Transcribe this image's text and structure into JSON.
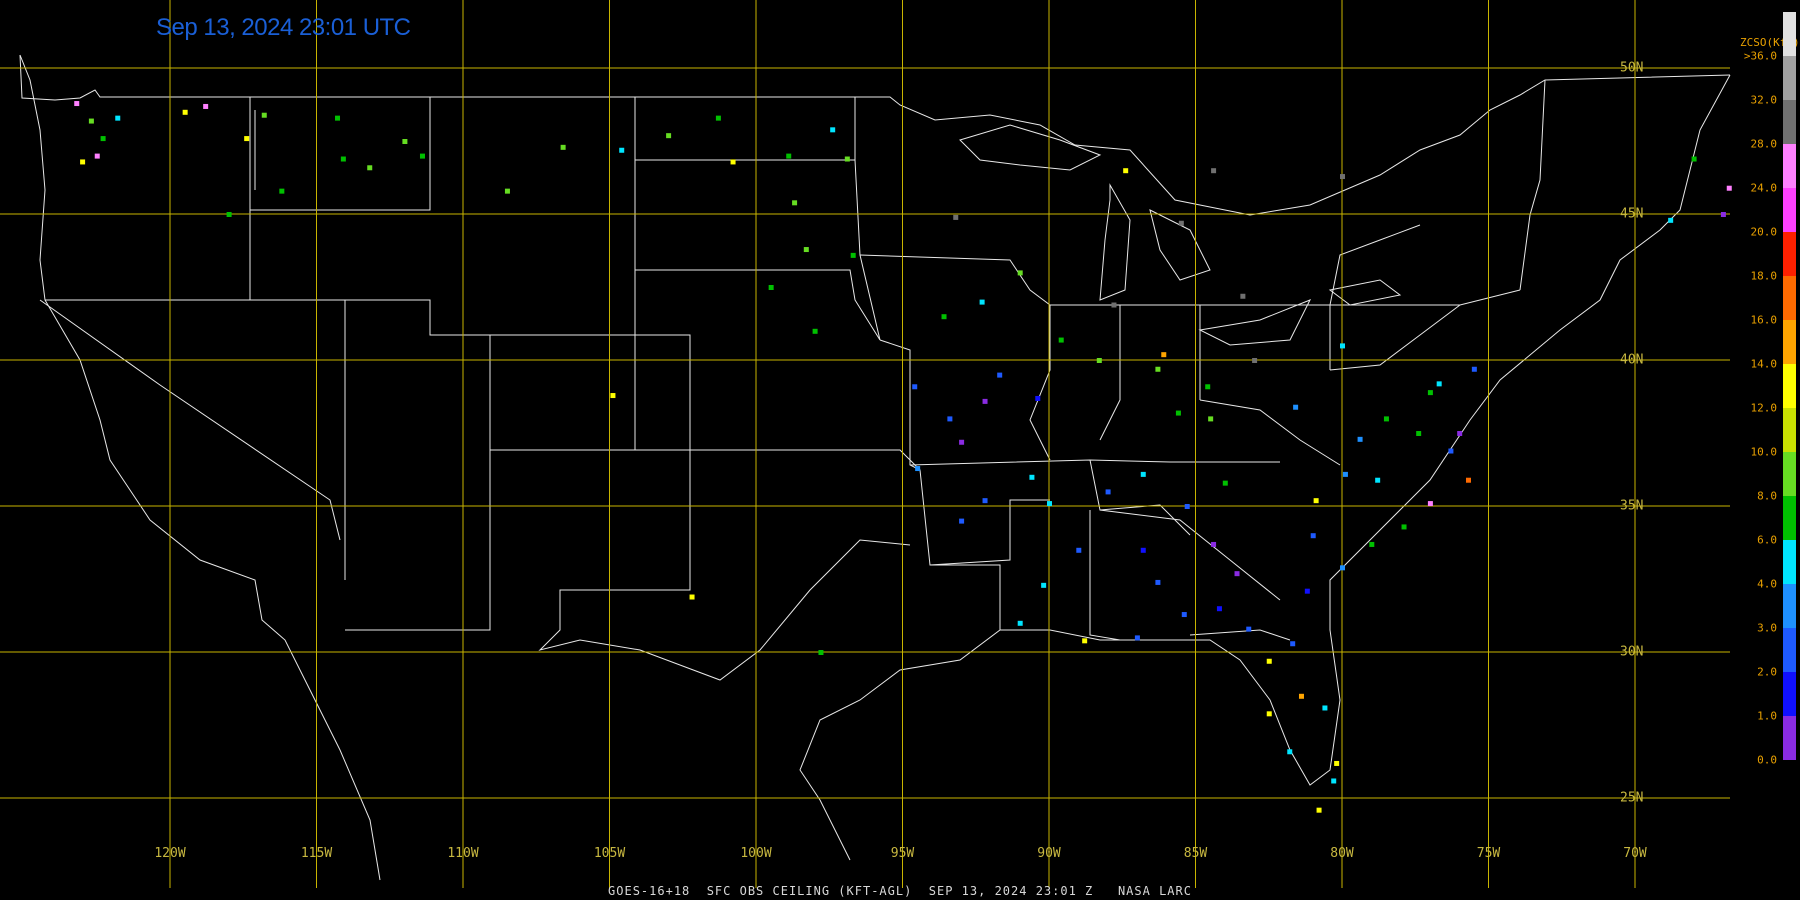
{
  "timestamp": "Sep 13, 2024 23:01 UTC",
  "footer": "GOES-16+18  SFC OBS CEILING (KFT-AGL)  SEP 13, 2024 23:01 Z   NASA LARC",
  "grid": {
    "longitudes": [
      {
        "lon": -120,
        "label": "120W"
      },
      {
        "lon": -115,
        "label": "115W"
      },
      {
        "lon": -110,
        "label": "110W"
      },
      {
        "lon": -105,
        "label": "105W"
      },
      {
        "lon": -100,
        "label": "100W"
      },
      {
        "lon": -95,
        "label": "95W"
      },
      {
        "lon": -90,
        "label": "90W"
      },
      {
        "lon": -85,
        "label": "85W"
      },
      {
        "lon": -80,
        "label": "80W"
      },
      {
        "lon": -75,
        "label": "75W"
      },
      {
        "lon": -70,
        "label": "70W"
      }
    ],
    "latitudes": [
      {
        "lat": 50,
        "label": "50N"
      },
      {
        "lat": 45,
        "label": "45N"
      },
      {
        "lat": 40,
        "label": "40N"
      },
      {
        "lat": 35,
        "label": "35N"
      },
      {
        "lat": 30,
        "label": "30N"
      },
      {
        "lat": 25,
        "label": "25N"
      }
    ],
    "color": "#c8b400"
  },
  "colorbar": {
    "title": "ZCSO(Kft)",
    "top_label": ">36.0",
    "ticks": [
      "0.0",
      "1.0",
      "2.0",
      "3.0",
      "4.0",
      "6.0",
      "8.0",
      "10.0",
      "12.0",
      "14.0",
      "16.0",
      "18.0",
      "20.0",
      "24.0",
      "28.0",
      "32.0"
    ],
    "colors": [
      "#8a2be2",
      "#1010ff",
      "#1e5aff",
      "#1e90ff",
      "#00e5ff",
      "#00c000",
      "#66dd22",
      "#c8e000",
      "#ffff00",
      "#ffa500",
      "#ff6a00",
      "#ff2000",
      "#ff40ff",
      "#ff80ff",
      "#707070",
      "#a0a0a0",
      "#e0e0e0"
    ]
  },
  "observations": [
    {
      "lon": -123.2,
      "lat": 48.8,
      "c": "#ff80ff"
    },
    {
      "lon": -122.7,
      "lat": 48.2,
      "c": "#66dd22"
    },
    {
      "lon": -122.3,
      "lat": 47.6,
      "c": "#00c000"
    },
    {
      "lon": -122.5,
      "lat": 47.0,
      "c": "#ff80ff"
    },
    {
      "lon": -123.0,
      "lat": 46.8,
      "c": "#ffff00"
    },
    {
      "lon": -121.8,
      "lat": 48.3,
      "c": "#00e5ff"
    },
    {
      "lon": -119.5,
      "lat": 48.5,
      "c": "#ffff00"
    },
    {
      "lon": -118.8,
      "lat": 48.7,
      "c": "#ff80ff"
    },
    {
      "lon": -117.4,
      "lat": 47.6,
      "c": "#ffff00"
    },
    {
      "lon": -116.8,
      "lat": 48.4,
      "c": "#66dd22"
    },
    {
      "lon": -114.3,
      "lat": 48.3,
      "c": "#00c000"
    },
    {
      "lon": -112.0,
      "lat": 47.5,
      "c": "#66dd22"
    },
    {
      "lon": -111.4,
      "lat": 47.0,
      "c": "#00c000"
    },
    {
      "lon": -113.2,
      "lat": 46.6,
      "c": "#66dd22"
    },
    {
      "lon": -114.1,
      "lat": 46.9,
      "c": "#00c000"
    },
    {
      "lon": -116.2,
      "lat": 45.8,
      "c": "#00c000"
    },
    {
      "lon": -118.0,
      "lat": 45.0,
      "c": "#00c000"
    },
    {
      "lon": -108.5,
      "lat": 45.8,
      "c": "#66dd22"
    },
    {
      "lon": -106.6,
      "lat": 47.3,
      "c": "#66dd22"
    },
    {
      "lon": -104.6,
      "lat": 47.2,
      "c": "#00e5ff"
    },
    {
      "lon": -103.0,
      "lat": 47.7,
      "c": "#66dd22"
    },
    {
      "lon": -101.3,
      "lat": 48.3,
      "c": "#00c000"
    },
    {
      "lon": -100.8,
      "lat": 46.8,
      "c": "#ffff00"
    },
    {
      "lon": -98.9,
      "lat": 47.0,
      "c": "#00c000"
    },
    {
      "lon": -97.4,
      "lat": 47.9,
      "c": "#00e5ff"
    },
    {
      "lon": -96.9,
      "lat": 46.9,
      "c": "#66dd22"
    },
    {
      "lon": -98.7,
      "lat": 45.4,
      "c": "#66dd22"
    },
    {
      "lon": -96.7,
      "lat": 43.6,
      "c": "#00c000"
    },
    {
      "lon": -99.5,
      "lat": 42.5,
      "c": "#00c000"
    },
    {
      "lon": -98.0,
      "lat": 41.0,
      "c": "#00c000"
    },
    {
      "lon": -98.3,
      "lat": 43.8,
      "c": "#66dd22"
    },
    {
      "lon": -104.9,
      "lat": 38.8,
      "c": "#ffff00"
    },
    {
      "lon": -97.8,
      "lat": 30.0,
      "c": "#00c000"
    },
    {
      "lon": -102.2,
      "lat": 31.9,
      "c": "#ffff00"
    },
    {
      "lon": -93.6,
      "lat": 41.5,
      "c": "#00c000"
    },
    {
      "lon": -92.3,
      "lat": 42.0,
      "c": "#00e5ff"
    },
    {
      "lon": -93.2,
      "lat": 44.9,
      "c": "#707070"
    },
    {
      "lon": -91.0,
      "lat": 43.0,
      "c": "#66dd22"
    },
    {
      "lon": -94.6,
      "lat": 39.1,
      "c": "#1e5aff"
    },
    {
      "lon": -93.4,
      "lat": 38.0,
      "c": "#1e5aff"
    },
    {
      "lon": -92.2,
      "lat": 38.6,
      "c": "#8a2be2"
    },
    {
      "lon": -90.4,
      "lat": 38.7,
      "c": "#1010ff"
    },
    {
      "lon": -91.7,
      "lat": 39.5,
      "c": "#1e5aff"
    },
    {
      "lon": -93.0,
      "lat": 37.2,
      "c": "#8a2be2"
    },
    {
      "lon": -94.5,
      "lat": 36.3,
      "c": "#1e90ff"
    },
    {
      "lon": -92.2,
      "lat": 35.2,
      "c": "#1e5aff"
    },
    {
      "lon": -93.0,
      "lat": 34.5,
      "c": "#1e5aff"
    },
    {
      "lon": -90.6,
      "lat": 36.0,
      "c": "#00e5ff"
    },
    {
      "lon": -89.6,
      "lat": 40.7,
      "c": "#00c000"
    },
    {
      "lon": -88.3,
      "lat": 40.0,
      "c": "#66dd22"
    },
    {
      "lon": -87.8,
      "lat": 41.9,
      "c": "#707070"
    },
    {
      "lon": -86.3,
      "lat": 39.7,
      "c": "#66dd22"
    },
    {
      "lon": -86.1,
      "lat": 40.2,
      "c": "#ffa500"
    },
    {
      "lon": -85.6,
      "lat": 38.2,
      "c": "#00c000"
    },
    {
      "lon": -84.6,
      "lat": 39.1,
      "c": "#00c000"
    },
    {
      "lon": -83.0,
      "lat": 40.0,
      "c": "#707070"
    },
    {
      "lon": -84.5,
      "lat": 38.0,
      "c": "#66dd22"
    },
    {
      "lon": -86.8,
      "lat": 36.1,
      "c": "#00e5ff"
    },
    {
      "lon": -85.3,
      "lat": 35.0,
      "c": "#1e5aff"
    },
    {
      "lon": -84.0,
      "lat": 35.8,
      "c": "#00c000"
    },
    {
      "lon": -88.0,
      "lat": 35.5,
      "c": "#1e5aff"
    },
    {
      "lon": -90.0,
      "lat": 35.1,
      "c": "#00e5ff"
    },
    {
      "lon": -89.0,
      "lat": 33.5,
      "c": "#1e5aff"
    },
    {
      "lon": -90.2,
      "lat": 32.3,
      "c": "#00e5ff"
    },
    {
      "lon": -91.0,
      "lat": 31.0,
      "c": "#00e5ff"
    },
    {
      "lon": -88.8,
      "lat": 30.4,
      "c": "#ffff00"
    },
    {
      "lon": -87.0,
      "lat": 30.5,
      "c": "#1e5aff"
    },
    {
      "lon": -86.8,
      "lat": 33.5,
      "c": "#1010ff"
    },
    {
      "lon": -86.3,
      "lat": 32.4,
      "c": "#1e5aff"
    },
    {
      "lon": -85.4,
      "lat": 31.3,
      "c": "#1e5aff"
    },
    {
      "lon": -84.4,
      "lat": 33.7,
      "c": "#8a2be2"
    },
    {
      "lon": -83.6,
      "lat": 32.7,
      "c": "#8a2be2"
    },
    {
      "lon": -84.2,
      "lat": 31.5,
      "c": "#1010ff"
    },
    {
      "lon": -83.2,
      "lat": 30.8,
      "c": "#1e5aff"
    },
    {
      "lon": -81.2,
      "lat": 32.1,
      "c": "#1010ff"
    },
    {
      "lon": -81.7,
      "lat": 30.3,
      "c": "#1e5aff"
    },
    {
      "lon": -82.5,
      "lat": 29.7,
      "c": "#ffff00"
    },
    {
      "lon": -81.4,
      "lat": 28.5,
      "c": "#ffa500"
    },
    {
      "lon": -82.5,
      "lat": 27.9,
      "c": "#ffff00"
    },
    {
      "lon": -80.6,
      "lat": 28.1,
      "c": "#00e5ff"
    },
    {
      "lon": -80.2,
      "lat": 26.2,
      "c": "#ffff00"
    },
    {
      "lon": -80.3,
      "lat": 25.6,
      "c": "#00e5ff"
    },
    {
      "lon": -81.8,
      "lat": 26.6,
      "c": "#00e5ff"
    },
    {
      "lon": -80.8,
      "lat": 24.6,
      "c": "#ffff00"
    },
    {
      "lon": -81.0,
      "lat": 34.0,
      "c": "#1e5aff"
    },
    {
      "lon": -80.0,
      "lat": 32.9,
      "c": "#1e90ff"
    },
    {
      "lon": -79.0,
      "lat": 33.7,
      "c": "#00c000"
    },
    {
      "lon": -80.9,
      "lat": 35.2,
      "c": "#ffff00"
    },
    {
      "lon": -79.9,
      "lat": 36.1,
      "c": "#1e90ff"
    },
    {
      "lon": -78.8,
      "lat": 35.9,
      "c": "#00e5ff"
    },
    {
      "lon": -77.9,
      "lat": 34.3,
      "c": "#00c000"
    },
    {
      "lon": -77.0,
      "lat": 35.1,
      "c": "#ff80ff"
    },
    {
      "lon": -76.3,
      "lat": 36.9,
      "c": "#1e5aff"
    },
    {
      "lon": -75.7,
      "lat": 35.9,
      "c": "#ff6a00"
    },
    {
      "lon": -76.0,
      "lat": 37.5,
      "c": "#8a2be2"
    },
    {
      "lon": -77.4,
      "lat": 37.5,
      "c": "#00c000"
    },
    {
      "lon": -78.5,
      "lat": 38.0,
      "c": "#00c000"
    },
    {
      "lon": -77.0,
      "lat": 38.9,
      "c": "#00c000"
    },
    {
      "lon": -76.7,
      "lat": 39.2,
      "c": "#00e5ff"
    },
    {
      "lon": -75.5,
      "lat": 39.7,
      "c": "#1e5aff"
    },
    {
      "lon": -79.4,
      "lat": 37.3,
      "c": "#1e90ff"
    },
    {
      "lon": -81.6,
      "lat": 38.4,
      "c": "#1e90ff"
    },
    {
      "lon": -80.0,
      "lat": 40.5,
      "c": "#00e5ff"
    },
    {
      "lon": -87.4,
      "lat": 46.5,
      "c": "#ffff00"
    },
    {
      "lon": -84.4,
      "lat": 46.5,
      "c": "#707070"
    },
    {
      "lon": -85.5,
      "lat": 44.7,
      "c": "#707070"
    },
    {
      "lon": -83.4,
      "lat": 42.2,
      "c": "#707070"
    },
    {
      "lon": -80.0,
      "lat": 46.3,
      "c": "#707070"
    },
    {
      "lon": -68.8,
      "lat": 44.8,
      "c": "#00e5ff"
    },
    {
      "lon": -68.0,
      "lat": 46.9,
      "c": "#00c000"
    },
    {
      "lon": -67.0,
      "lat": 45.0,
      "c": "#8a2be2"
    },
    {
      "lon": -66.8,
      "lat": 45.9,
      "c": "#ff80ff"
    }
  ]
}
